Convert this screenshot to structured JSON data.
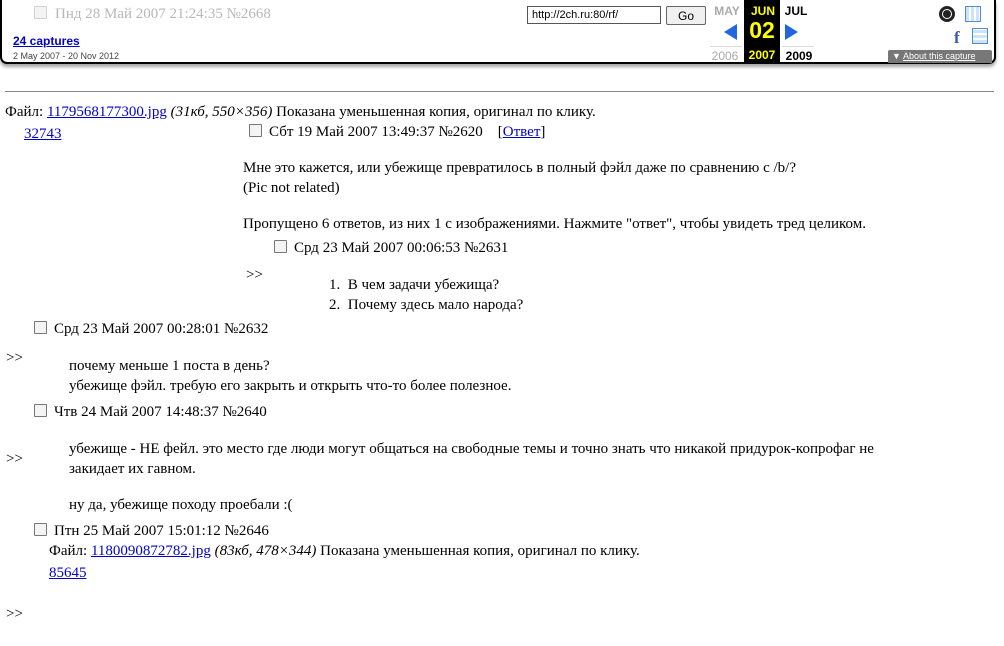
{
  "toolbar": {
    "ghost_post": "Пнд 28 Май 2007 21:24:35 №2668",
    "captures": "24 captures",
    "capture_range": "2 May 2007 - 20 Nov 2012",
    "url_value": "http://2ch.ru:80/rf/",
    "go_label": "Go",
    "prev_month": "MAY",
    "current_month": "JUN",
    "next_month": "JUL",
    "current_day": "02",
    "prev_year": "2006",
    "current_year": "2007",
    "next_year": "2009",
    "about": "About this capture",
    "about_icon": "▼",
    "facebook_glyph": "f",
    "icons": [
      "alexa-icon",
      "qr-icon",
      "facebook-icon",
      "qr-icon-2"
    ]
  },
  "op": {
    "file_label": "Файл:",
    "file_name": "1179568177300.jpg",
    "file_meta": "(31кб, 550×356)",
    "file_note": "Показана уменьшенная копия, оригинал по клику.",
    "thumb_id": "32743",
    "date": "Сбт 19 Май 2007 13:49:37 №2620",
    "reply_open": "[",
    "reply_link": "Ответ",
    "reply_close": "]",
    "text_1": "Мне это кажется, или убежище превратилось в полный фэйл даже по сравнению с /b/?",
    "text_2": "(Pic not related)",
    "omitted": "Пропущено 6 ответов, из них 1 с изображениями. Нажмите \"ответ\", чтобы увидеть тред целиком."
  },
  "posts": [
    {
      "marker": ">>",
      "date": "Срд 23 Май 2007 00:06:53 №2631",
      "items": [
        "В чем задачи убежища?",
        "Почему здесь мало народа?"
      ]
    },
    {
      "marker": ">>",
      "date": "Срд 23 Май 2007 00:28:01 №2632",
      "lines": [
        "почему меньше 1 поста в день?",
        "убежище фэйл. требую его закрыть и открыть что-то более полезное."
      ]
    },
    {
      "marker": ">>",
      "date": "Чтв 24 Май 2007 14:48:37 №2640",
      "lines": [
        "убежище - НЕ фейл. это место где люди могут общаться на свободные темы и точно знать что никакой придурок-копрофаг не",
        "закидает их гавном.",
        "ну да, убежище походу проебали :("
      ]
    },
    {
      "marker": ">>",
      "date": "Птн 25 Май 2007 15:01:12 №2646",
      "file_label": "Файл:",
      "file_name": "1180090872782.jpg",
      "file_meta": "(83кб, 478×344)",
      "file_note": "Показана уменьшенная копия, оригинал по клику.",
      "thumb_id": "85645"
    }
  ]
}
